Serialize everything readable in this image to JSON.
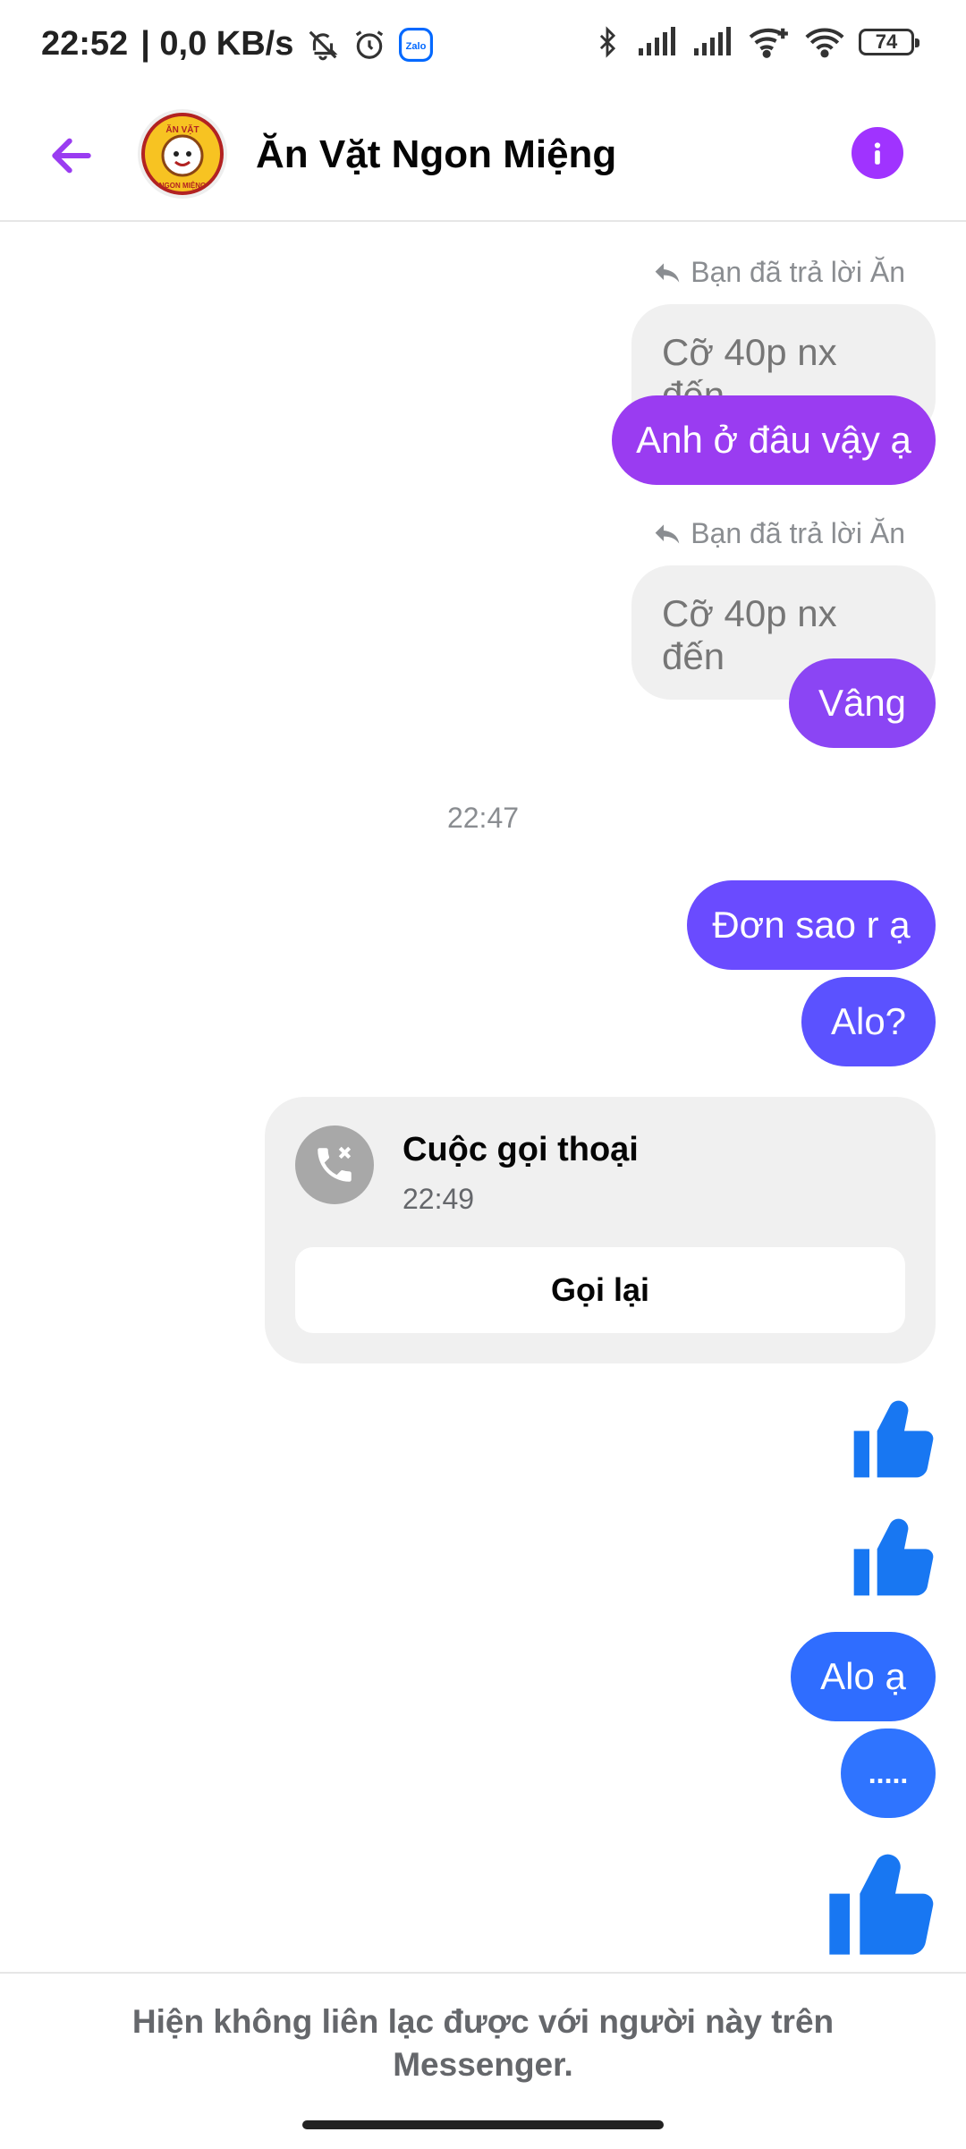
{
  "status_bar": {
    "time": "22:52",
    "network_speed": "| 0,0 KB/s",
    "zalo_label": "Zalo",
    "battery": "74"
  },
  "header": {
    "title": "Ăn Vặt Ngon Miệng",
    "avatar_text_top": "ĂN VẶT",
    "avatar_text_bottom": "NGON MIỆNG"
  },
  "messages": {
    "reply1": {
      "note": "Bạn đã trả lời Ăn",
      "quoted": "Cỡ 40p nx đến",
      "text": "Anh ở đâu vậy ạ"
    },
    "reply2": {
      "note": "Bạn đã trả lời Ăn",
      "quoted": "Cỡ 40p nx đến",
      "text": "Vâng"
    },
    "timestamp": "22:47",
    "msg_don_sao": "Đơn sao r ạ",
    "msg_alo": "Alo?",
    "call": {
      "title": "Cuộc gọi thoại",
      "time": "22:49",
      "button": "Gọi lại"
    },
    "msg_alo_a": "Alo ạ",
    "msg_dots": "....."
  },
  "footer": {
    "notice": "Hiện không liên lạc được với người này trên Messenger."
  },
  "colors": {
    "purple_bubble": "#9a3cf1",
    "indigo_bubble": "#6a4bff",
    "blue_bubble": "#2f6dff",
    "like_blue": "#1877f2",
    "header_accent": "#a033ff"
  }
}
